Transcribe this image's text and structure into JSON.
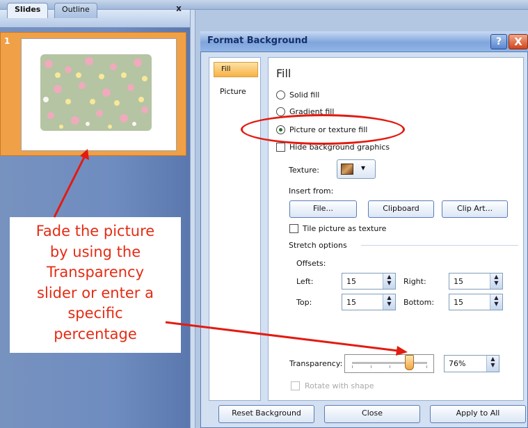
{
  "left_panel": {
    "tabs": [
      "Slides",
      "Outline"
    ],
    "close_glyph": "x",
    "slide_number": "1"
  },
  "callout": {
    "lines": [
      "Fade the picture",
      "by using the",
      "Transparency",
      "slider or enter a",
      "specific",
      "percentage"
    ]
  },
  "dialog": {
    "title": "Format Background",
    "help_glyph": "?",
    "close_glyph": "X",
    "categories": [
      "Fill",
      "Picture"
    ],
    "section_title": "Fill",
    "options": {
      "solid_fill": "Solid fill",
      "gradient_fill": "Gradient fill",
      "picture_texture_fill": "Picture or texture fill",
      "hide_background": "Hide background graphics"
    },
    "selected_fill_option": "Picture or texture fill",
    "texture_label": "Texture:",
    "insert_from_label": "Insert from:",
    "insert_buttons": [
      "File...",
      "Clipboard",
      "Clip Art..."
    ],
    "tile_label": "Tile picture as texture",
    "stretch_options_label": "Stretch options",
    "offsets_label": "Offsets:",
    "offsets": {
      "left_label": "Left:",
      "left_value": "15",
      "right_label": "Right:",
      "right_value": "15",
      "top_label": "Top:",
      "top_value": "15",
      "bottom_label": "Bottom:",
      "bottom_value": "15"
    },
    "transparency_label": "Transparency:",
    "transparency_value": "76%",
    "transparency_level": 0.76,
    "rotate_label": "Rotate with shape",
    "footer_buttons": [
      "Reset Background",
      "Close",
      "Apply to All"
    ]
  },
  "colors": {
    "accent_orange": "#f0a046",
    "annotation_red": "#e31b10",
    "dialog_bg": "#d3e0f1"
  },
  "icons": {
    "texture_dropdown": "texture-icon",
    "spin_up": "▲",
    "spin_down": "▼",
    "dropdown_arrow": "▾"
  }
}
